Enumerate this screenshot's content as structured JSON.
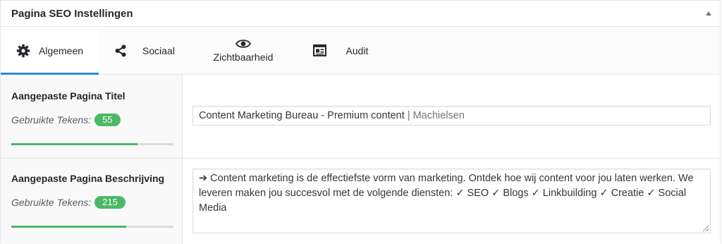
{
  "panel": {
    "title": "Pagina SEO Instellingen"
  },
  "tabs": [
    {
      "label": "Algemeen",
      "icon": "gear-icon",
      "active": true
    },
    {
      "label": "Sociaal",
      "icon": "share-icon",
      "active": false
    },
    {
      "label": "Zichtbaarheid",
      "icon": "eye-icon",
      "active": false
    },
    {
      "label": "Audit",
      "icon": "audit-icon",
      "active": false
    }
  ],
  "fields": {
    "title": {
      "label": "Aangepaste Pagina Titel",
      "counter_label": "Gebruikte Tekens:",
      "count": "55",
      "meter_fraction": 0.78,
      "value": "Content Marketing Bureau - Premium content",
      "suffix": " | Machielsen"
    },
    "description": {
      "label": "Aangepaste Pagina Beschrijving",
      "counter_label": "Gebruikte Tekens:",
      "count": "215",
      "meter_fraction": 0.71,
      "value": "➔ Content marketing is de effectiefste vorm van marketing. Ontdek hoe wij content voor jou laten werken. We leveren maken jou succesvol met de volgende diensten: ✓ SEO ✓ Blogs ✓ Linkbuilding ✓ Creatie ✓ Social Media"
    }
  },
  "colors": {
    "accent": "#2e8bd6",
    "badge": "#4ab866"
  }
}
